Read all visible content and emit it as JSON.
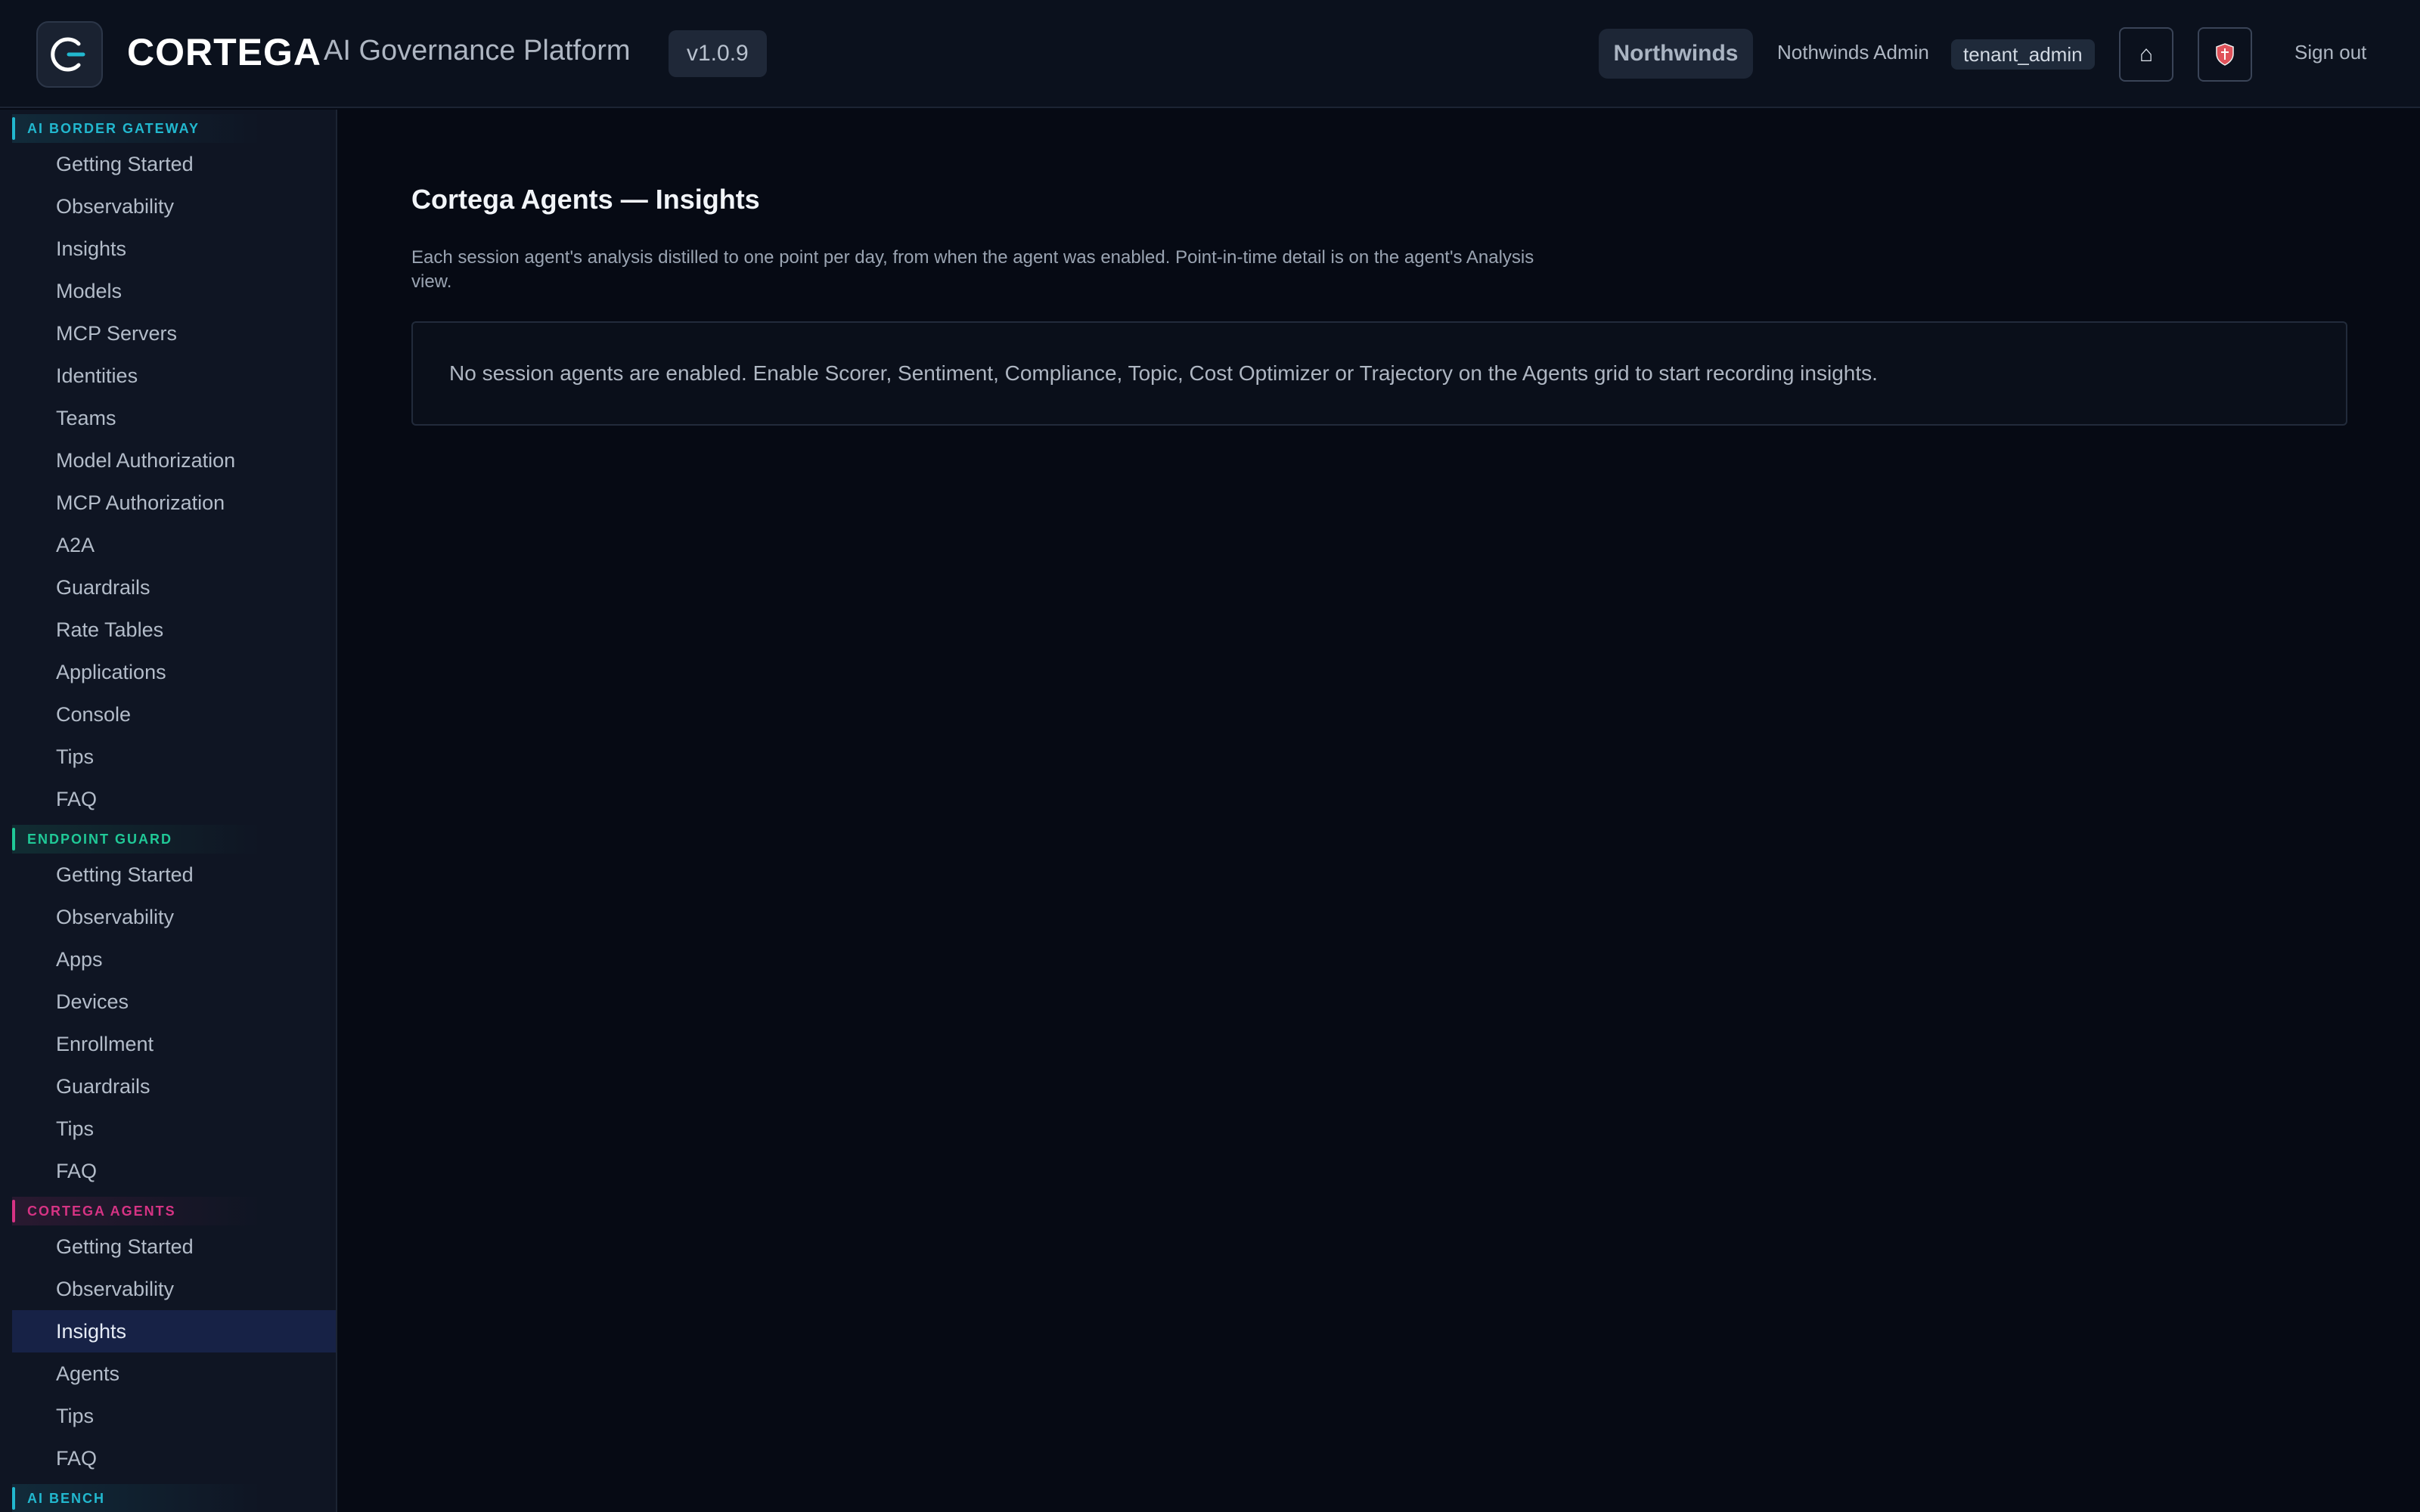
{
  "header": {
    "brand": "CORTEGA",
    "platform": "AI Governance Platform",
    "version": "v1.0.9",
    "tenant": "Northwinds",
    "user": "Nothwinds Admin",
    "role": "tenant_admin",
    "home_icon": "⌂",
    "signout": "Sign out"
  },
  "sidebar": {
    "sections": [
      {
        "title": "AI BORDER GATEWAY",
        "accent": "#22b8cf",
        "items": [
          "Getting Started",
          "Observability",
          "Insights",
          "Models",
          "MCP Servers",
          "Identities",
          "Teams",
          "Model Authorization",
          "MCP Authorization",
          "A2A",
          "Guardrails",
          "Rate Tables",
          "Applications",
          "Console",
          "Tips",
          "FAQ"
        ]
      },
      {
        "title": "ENDPOINT GUARD",
        "accent": "#20c997",
        "items": [
          "Getting Started",
          "Observability",
          "Apps",
          "Devices",
          "Enrollment",
          "Guardrails",
          "Tips",
          "FAQ"
        ]
      },
      {
        "title": "CORTEGA AGENTS",
        "accent": "#d63384",
        "items": [
          "Getting Started",
          "Observability",
          "Insights",
          "Agents",
          "Tips",
          "FAQ"
        ]
      },
      {
        "title": "AI BENCH",
        "accent": "#22b8cf",
        "items": []
      }
    ],
    "active": {
      "section": 2,
      "item": 2
    }
  },
  "main": {
    "title": "Cortega Agents — Insights",
    "description": "Each session agent's analysis distilled to one point per day, from when the agent was enabled. Point-in-time detail is on the agent's Analysis view.",
    "empty_message": "No session agents are enabled. Enable Scorer, Sentiment, Compliance, Topic, Cost Optimizer or Trajectory on the Agents grid to start recording insights."
  }
}
